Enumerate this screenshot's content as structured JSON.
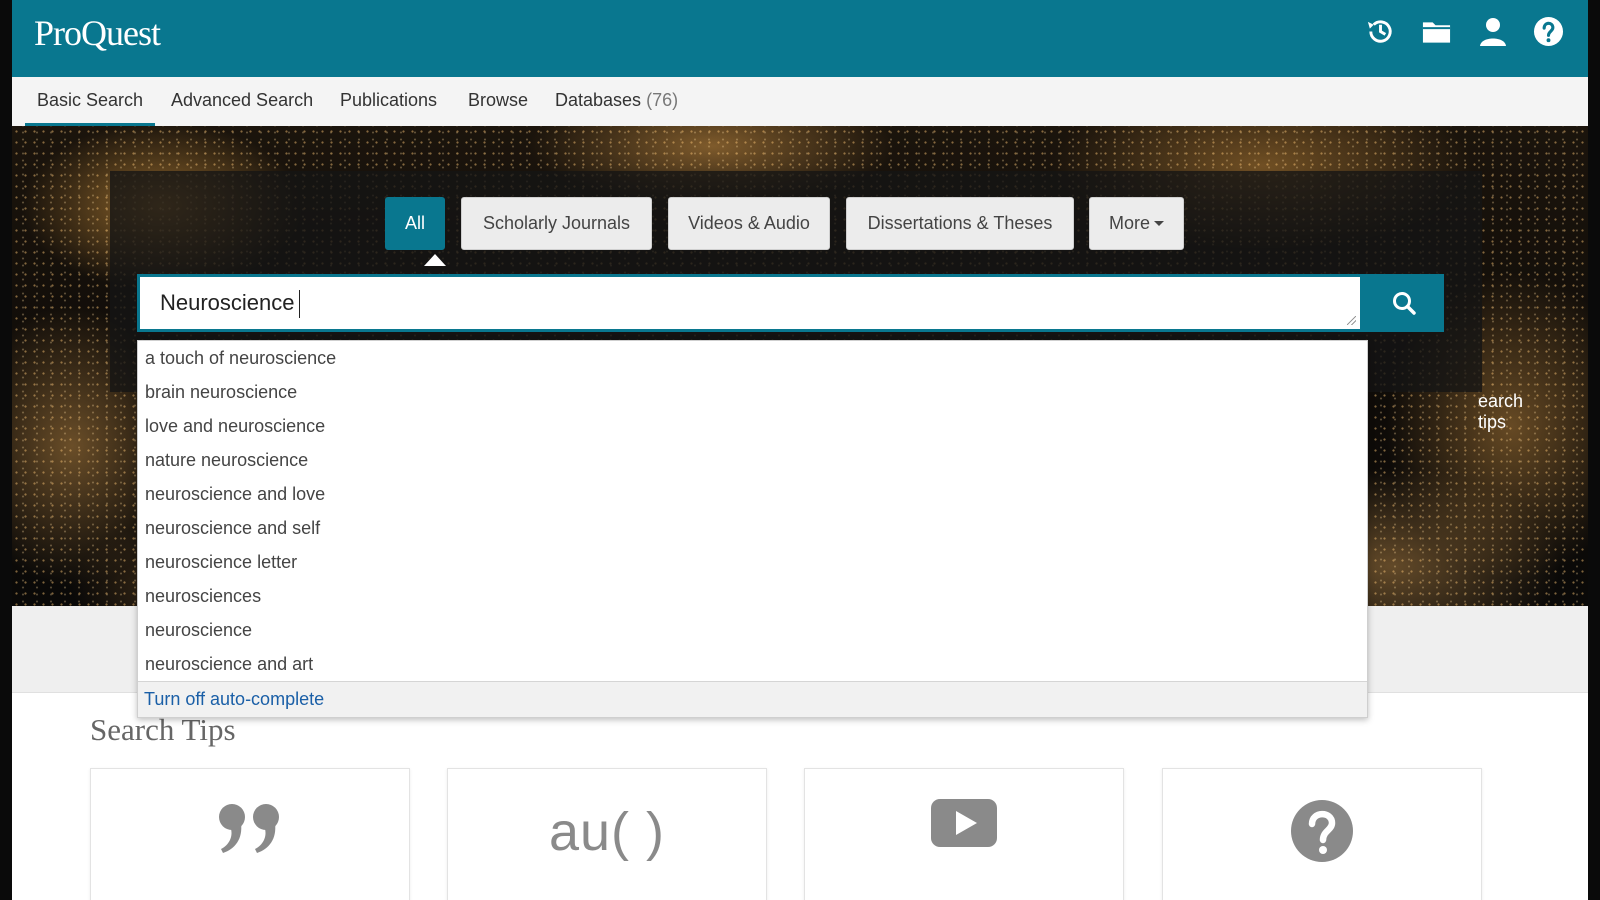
{
  "header": {
    "logo": "ProQuest",
    "icons": [
      "history-icon",
      "folder-icon",
      "user-icon",
      "help-icon"
    ]
  },
  "nav": {
    "items": [
      {
        "label": "Basic Search",
        "active": true
      },
      {
        "label": "Advanced Search"
      },
      {
        "label": "Publications"
      },
      {
        "label": "Browse"
      },
      {
        "label": "Databases",
        "count": "(76)"
      }
    ]
  },
  "source_filters": {
    "items": [
      "All",
      "Scholarly Journals",
      "Videos & Audio",
      "Dissertations & Theses",
      "More"
    ],
    "active": "All"
  },
  "search": {
    "value": "Neuroscience",
    "tips_link": "earch tips"
  },
  "autocomplete": {
    "suggestions": [
      "a touch of neuroscience",
      "brain neuroscience",
      "love and neuroscience",
      "nature neuroscience",
      "neuroscience and love",
      "neuroscience and self",
      "neuroscience letter",
      "neurosciences",
      "neuroscience",
      "neuroscience and art"
    ],
    "footer": "Turn off auto-complete"
  },
  "search_tips": {
    "heading": "Search Tips",
    "cards": [
      {
        "icon": "quote-icon"
      },
      {
        "icon": "author-field-icon",
        "text": "au( )"
      },
      {
        "icon": "video-play-icon"
      },
      {
        "icon": "help-circle-icon"
      }
    ]
  },
  "colors": {
    "brand_teal": "#09778f",
    "link_blue": "#1a5fa7"
  }
}
